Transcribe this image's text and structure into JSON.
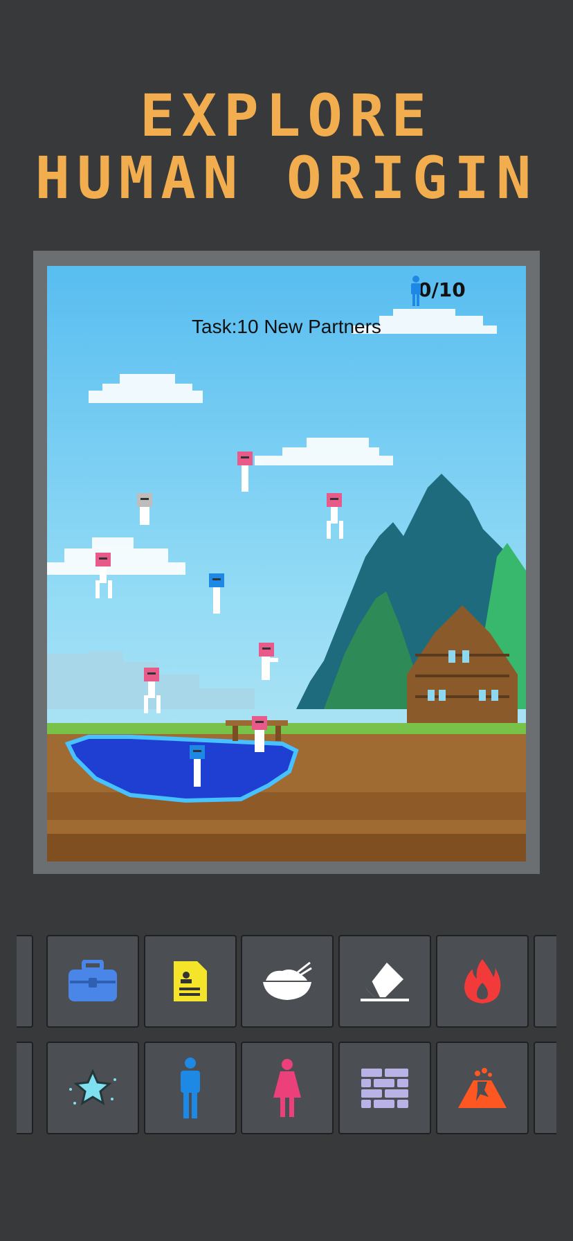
{
  "header": {
    "title_line1": "EXPLORE",
    "title_line2": "HUMAN ORIGIN"
  },
  "game": {
    "population_counter": "0/10",
    "task_label": "Task:10 New Partners"
  },
  "toolbar": {
    "row1": [
      {
        "icon": "briefcase-icon",
        "color": "#4a86e8"
      },
      {
        "icon": "document-icon",
        "color": "#f5e52a"
      },
      {
        "icon": "rice-bowl-icon",
        "color": "#ffffff"
      },
      {
        "icon": "eraser-icon",
        "color": "#ffffff"
      },
      {
        "icon": "fire-icon",
        "color": "#f23a3a"
      }
    ],
    "row2": [
      {
        "icon": "star-icon",
        "color": "#7fe0f0"
      },
      {
        "icon": "male-person-icon",
        "color": "#1e88e5"
      },
      {
        "icon": "female-person-icon",
        "color": "#ec407a"
      },
      {
        "icon": "brick-wall-icon",
        "color": "#b9b2e6"
      },
      {
        "icon": "volcano-icon",
        "color": "#ff5722"
      }
    ]
  },
  "colors": {
    "background": "#37393b",
    "title": "#f2ad4e",
    "male_head": "#1e88e5",
    "female_head": "#e85a8a"
  }
}
